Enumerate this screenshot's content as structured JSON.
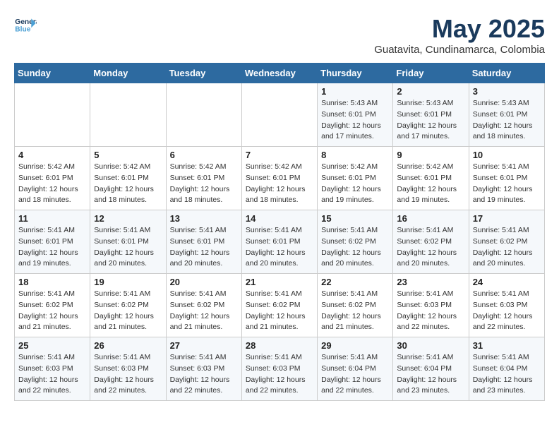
{
  "header": {
    "logo_line1": "General",
    "logo_line2": "Blue",
    "month_title": "May 2025",
    "subtitle": "Guatavita, Cundinamarca, Colombia"
  },
  "days_of_week": [
    "Sunday",
    "Monday",
    "Tuesday",
    "Wednesday",
    "Thursday",
    "Friday",
    "Saturday"
  ],
  "weeks": [
    [
      {
        "day": "",
        "info": ""
      },
      {
        "day": "",
        "info": ""
      },
      {
        "day": "",
        "info": ""
      },
      {
        "day": "",
        "info": ""
      },
      {
        "day": "1",
        "info": "Sunrise: 5:43 AM\nSunset: 6:01 PM\nDaylight: 12 hours\nand 17 minutes."
      },
      {
        "day": "2",
        "info": "Sunrise: 5:43 AM\nSunset: 6:01 PM\nDaylight: 12 hours\nand 17 minutes."
      },
      {
        "day": "3",
        "info": "Sunrise: 5:43 AM\nSunset: 6:01 PM\nDaylight: 12 hours\nand 18 minutes."
      }
    ],
    [
      {
        "day": "4",
        "info": "Sunrise: 5:42 AM\nSunset: 6:01 PM\nDaylight: 12 hours\nand 18 minutes."
      },
      {
        "day": "5",
        "info": "Sunrise: 5:42 AM\nSunset: 6:01 PM\nDaylight: 12 hours\nand 18 minutes."
      },
      {
        "day": "6",
        "info": "Sunrise: 5:42 AM\nSunset: 6:01 PM\nDaylight: 12 hours\nand 18 minutes."
      },
      {
        "day": "7",
        "info": "Sunrise: 5:42 AM\nSunset: 6:01 PM\nDaylight: 12 hours\nand 18 minutes."
      },
      {
        "day": "8",
        "info": "Sunrise: 5:42 AM\nSunset: 6:01 PM\nDaylight: 12 hours\nand 19 minutes."
      },
      {
        "day": "9",
        "info": "Sunrise: 5:42 AM\nSunset: 6:01 PM\nDaylight: 12 hours\nand 19 minutes."
      },
      {
        "day": "10",
        "info": "Sunrise: 5:41 AM\nSunset: 6:01 PM\nDaylight: 12 hours\nand 19 minutes."
      }
    ],
    [
      {
        "day": "11",
        "info": "Sunrise: 5:41 AM\nSunset: 6:01 PM\nDaylight: 12 hours\nand 19 minutes."
      },
      {
        "day": "12",
        "info": "Sunrise: 5:41 AM\nSunset: 6:01 PM\nDaylight: 12 hours\nand 20 minutes."
      },
      {
        "day": "13",
        "info": "Sunrise: 5:41 AM\nSunset: 6:01 PM\nDaylight: 12 hours\nand 20 minutes."
      },
      {
        "day": "14",
        "info": "Sunrise: 5:41 AM\nSunset: 6:01 PM\nDaylight: 12 hours\nand 20 minutes."
      },
      {
        "day": "15",
        "info": "Sunrise: 5:41 AM\nSunset: 6:02 PM\nDaylight: 12 hours\nand 20 minutes."
      },
      {
        "day": "16",
        "info": "Sunrise: 5:41 AM\nSunset: 6:02 PM\nDaylight: 12 hours\nand 20 minutes."
      },
      {
        "day": "17",
        "info": "Sunrise: 5:41 AM\nSunset: 6:02 PM\nDaylight: 12 hours\nand 20 minutes."
      }
    ],
    [
      {
        "day": "18",
        "info": "Sunrise: 5:41 AM\nSunset: 6:02 PM\nDaylight: 12 hours\nand 21 minutes."
      },
      {
        "day": "19",
        "info": "Sunrise: 5:41 AM\nSunset: 6:02 PM\nDaylight: 12 hours\nand 21 minutes."
      },
      {
        "day": "20",
        "info": "Sunrise: 5:41 AM\nSunset: 6:02 PM\nDaylight: 12 hours\nand 21 minutes."
      },
      {
        "day": "21",
        "info": "Sunrise: 5:41 AM\nSunset: 6:02 PM\nDaylight: 12 hours\nand 21 minutes."
      },
      {
        "day": "22",
        "info": "Sunrise: 5:41 AM\nSunset: 6:02 PM\nDaylight: 12 hours\nand 21 minutes."
      },
      {
        "day": "23",
        "info": "Sunrise: 5:41 AM\nSunset: 6:03 PM\nDaylight: 12 hours\nand 22 minutes."
      },
      {
        "day": "24",
        "info": "Sunrise: 5:41 AM\nSunset: 6:03 PM\nDaylight: 12 hours\nand 22 minutes."
      }
    ],
    [
      {
        "day": "25",
        "info": "Sunrise: 5:41 AM\nSunset: 6:03 PM\nDaylight: 12 hours\nand 22 minutes."
      },
      {
        "day": "26",
        "info": "Sunrise: 5:41 AM\nSunset: 6:03 PM\nDaylight: 12 hours\nand 22 minutes."
      },
      {
        "day": "27",
        "info": "Sunrise: 5:41 AM\nSunset: 6:03 PM\nDaylight: 12 hours\nand 22 minutes."
      },
      {
        "day": "28",
        "info": "Sunrise: 5:41 AM\nSunset: 6:03 PM\nDaylight: 12 hours\nand 22 minutes."
      },
      {
        "day": "29",
        "info": "Sunrise: 5:41 AM\nSunset: 6:04 PM\nDaylight: 12 hours\nand 22 minutes."
      },
      {
        "day": "30",
        "info": "Sunrise: 5:41 AM\nSunset: 6:04 PM\nDaylight: 12 hours\nand 23 minutes."
      },
      {
        "day": "31",
        "info": "Sunrise: 5:41 AM\nSunset: 6:04 PM\nDaylight: 12 hours\nand 23 minutes."
      }
    ]
  ]
}
